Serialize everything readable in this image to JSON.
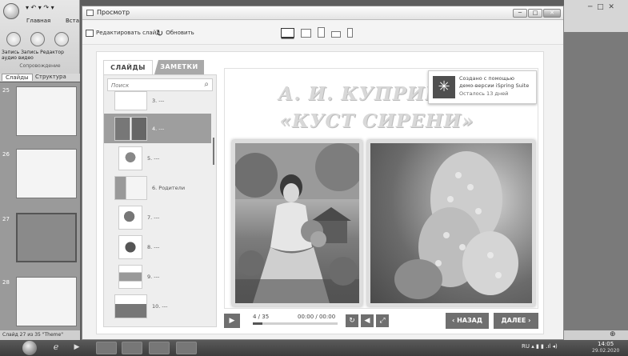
{
  "ppt": {
    "quick_access": "▾ ↶ ▾ ↷ ▾",
    "tab_home": "Главная",
    "tab_insert": "Вста",
    "ribbon_label_1": "Запись  Запись  Редактор",
    "ribbon_label_2": "аудио   видео",
    "ribbon_group": "Сопровождение",
    "panel_tab_slides": "Слайды",
    "panel_tab_structure": "Структура",
    "thumb_numbers": [
      "25",
      "26",
      "27",
      "28"
    ],
    "status": "Слайд 27 из 35  \"Theme\""
  },
  "preview": {
    "title": "Просмотр",
    "edit_slide": "Редактировать слайд",
    "refresh": "Обновить",
    "win_min": "─",
    "win_max": "□",
    "win_close": "✕"
  },
  "player": {
    "tab_slides": "СЛАЙДЫ",
    "tab_notes": "ЗАМЕТКИ",
    "search_placeholder": "Поиск",
    "slides": [
      {
        "label": "3. ---"
      },
      {
        "label": "4. ---",
        "selected": true
      },
      {
        "label": "5. ---"
      },
      {
        "label": "6. Родители"
      },
      {
        "label": "7. ---"
      },
      {
        "label": "8. ---"
      },
      {
        "label": "9. ---"
      },
      {
        "label": "10. ---"
      }
    ],
    "slide_title_1": "А. И. КУПРИН",
    "slide_title_2": "«КУСТ СИРЕНИ»",
    "demo_line1": "Создано с помощью",
    "demo_line2": "демо-версии iSpring Suite",
    "demo_line3": "Осталось 13 дней",
    "slide_counter": "4 / 35",
    "time": "00:00 / 00:00",
    "progress": 0.11,
    "prev": "‹ НАЗАД",
    "next": "ДАЛЕЕ ›"
  },
  "taskbar": {
    "tray": "RU  ▴  ▮  ▮  .ıl  ◂)",
    "time": "14:05",
    "date": "29.02.2020"
  },
  "colors": {
    "accent_gray": "#6f6f6f",
    "selected_slide": "#9e9e9e"
  }
}
